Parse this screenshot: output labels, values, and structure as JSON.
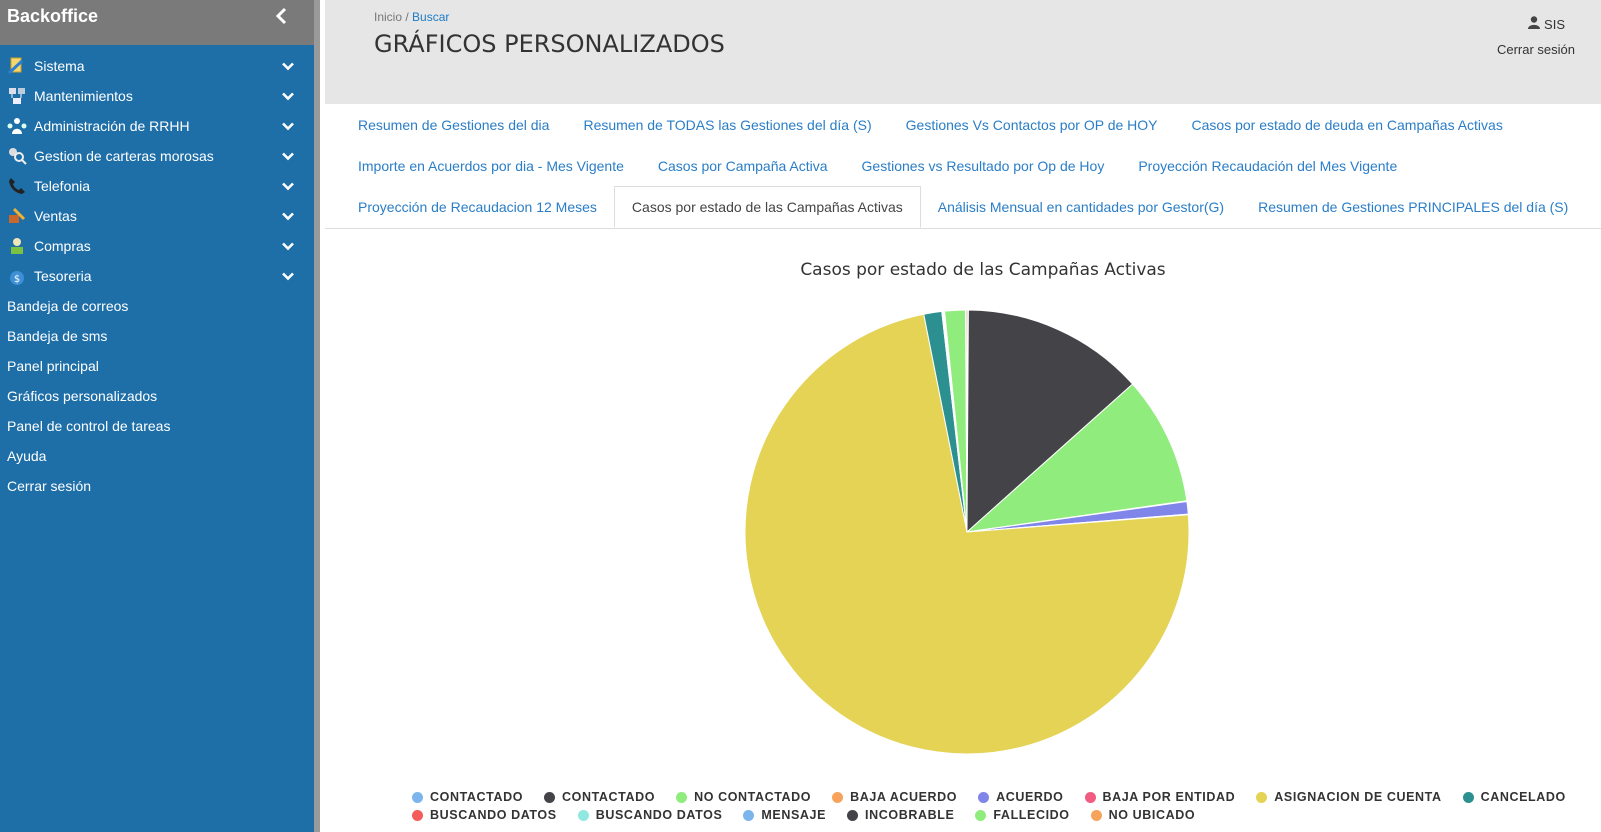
{
  "sidebar": {
    "brand": "Backoffice",
    "menu": [
      {
        "label": "Sistema",
        "icon": "system-icon"
      },
      {
        "label": "Mantenimientos",
        "icon": "maintenance-icon"
      },
      {
        "label": "Administración de RRHH",
        "icon": "hr-icon"
      },
      {
        "label": "Gestion de carteras morosas",
        "icon": "search-user-icon"
      },
      {
        "label": "Telefonia",
        "icon": "phone-icon"
      },
      {
        "label": "Ventas",
        "icon": "sales-icon"
      },
      {
        "label": "Compras",
        "icon": "purchases-icon"
      },
      {
        "label": "Tesoreria",
        "icon": "money-bag-icon"
      }
    ],
    "links": [
      "Bandeja de correos",
      "Bandeja de sms",
      "Panel principal",
      "Gráficos personalizados",
      "Panel de control de tareas",
      "Ayuda",
      "Cerrar sesión"
    ]
  },
  "header": {
    "breadcrumb_home": "Inicio",
    "breadcrumb_sep": "/",
    "breadcrumb_current": "Buscar",
    "title": "GRÁFICOS PERSONALIZADOS",
    "user": "SIS",
    "logout": "Cerrar sesión"
  },
  "tabs": [
    [
      "Resumen de Gestiones del dia",
      "Resumen de TODAS las Gestiones del día (S)",
      "Gestiones Vs Contactos por OP de HOY",
      "Casos por estado de deuda en Campañas Activas"
    ],
    [
      "Importe en Acuerdos por dia - Mes Vigente",
      "Casos por Campaña Activa",
      "Gestiones vs Resultado por Op de Hoy",
      "Proyección Recaudación del Mes Vigente"
    ],
    [
      "Proyección de Recaudacion 12 Meses",
      "Casos por estado de las Campañas Activas",
      "Análisis Mensual en cantidades por Gestor(G)",
      "Resumen de Gestiones PRINCIPALES del día (S)"
    ]
  ],
  "active_tab": "Casos por estado de las Campañas Activas",
  "chart_data": {
    "type": "pie",
    "title": "Casos por estado de las Campañas Activas",
    "series": [
      {
        "name": "CONTACTADO",
        "value": 0.1,
        "color": "#7cb5ec"
      },
      {
        "name": "CONTACTADO",
        "value": 13.2,
        "color": "#434348"
      },
      {
        "name": "NO CONTACTADO",
        "value": 9.3,
        "color": "#90ed7d"
      },
      {
        "name": "BAJA ACUERDO",
        "value": 0.05,
        "color": "#f7a35c"
      },
      {
        "name": "ACUERDO",
        "value": 0.9,
        "color": "#8085e9"
      },
      {
        "name": "BAJA POR ENTIDAD",
        "value": 0.05,
        "color": "#f15c80"
      },
      {
        "name": "ASIGNACION DE CUENTA",
        "value": 72.6,
        "color": "#e4d354"
      },
      {
        "name": "CANCELADO",
        "value": 1.3,
        "color": "#2b908f"
      },
      {
        "name": "BUSCANDO DATOS",
        "value": 0.05,
        "color": "#f45b5b"
      },
      {
        "name": "BUSCANDO DATOS",
        "value": 0.05,
        "color": "#91e8e1"
      },
      {
        "name": "MENSAJE",
        "value": 0.05,
        "color": "#7cb5ec"
      },
      {
        "name": "INCOBRABLE",
        "value": 0.05,
        "color": "#434348"
      },
      {
        "name": "FALLECIDO",
        "value": 1.5,
        "color": "#90ed7d"
      },
      {
        "name": "NO UBICADO",
        "value": 0.1,
        "color": "#f7a35c"
      }
    ],
    "legend_rows": [
      8,
      6
    ]
  }
}
